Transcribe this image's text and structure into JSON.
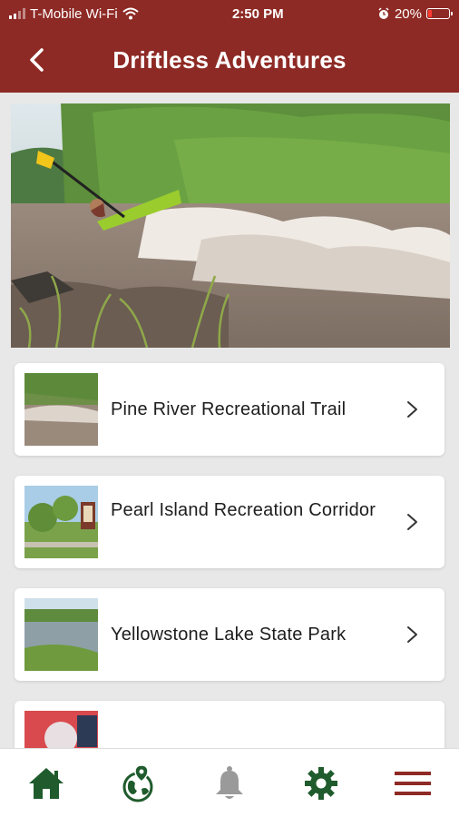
{
  "status": {
    "carrier": "T-Mobile Wi-Fi",
    "time": "2:50 PM",
    "battery": "20%",
    "battery_level": 0.2
  },
  "header": {
    "title": "Driftless Adventures"
  },
  "list": [
    {
      "label": "Pine River Recreational Trail"
    },
    {
      "label": "Pearl Island Recreation Corridor"
    },
    {
      "label": "Yellowstone Lake State Park"
    }
  ],
  "tabs": [
    {
      "icon": "home-icon"
    },
    {
      "icon": "globe-pin-icon"
    },
    {
      "icon": "bell-icon"
    },
    {
      "icon": "gear-icon"
    },
    {
      "icon": "menu-icon"
    }
  ],
  "colors": {
    "header": "#8e2a25",
    "tab_green": "#1f5b2c",
    "tab_gray": "#9a9a9a",
    "menu_red": "#8e2a25"
  }
}
